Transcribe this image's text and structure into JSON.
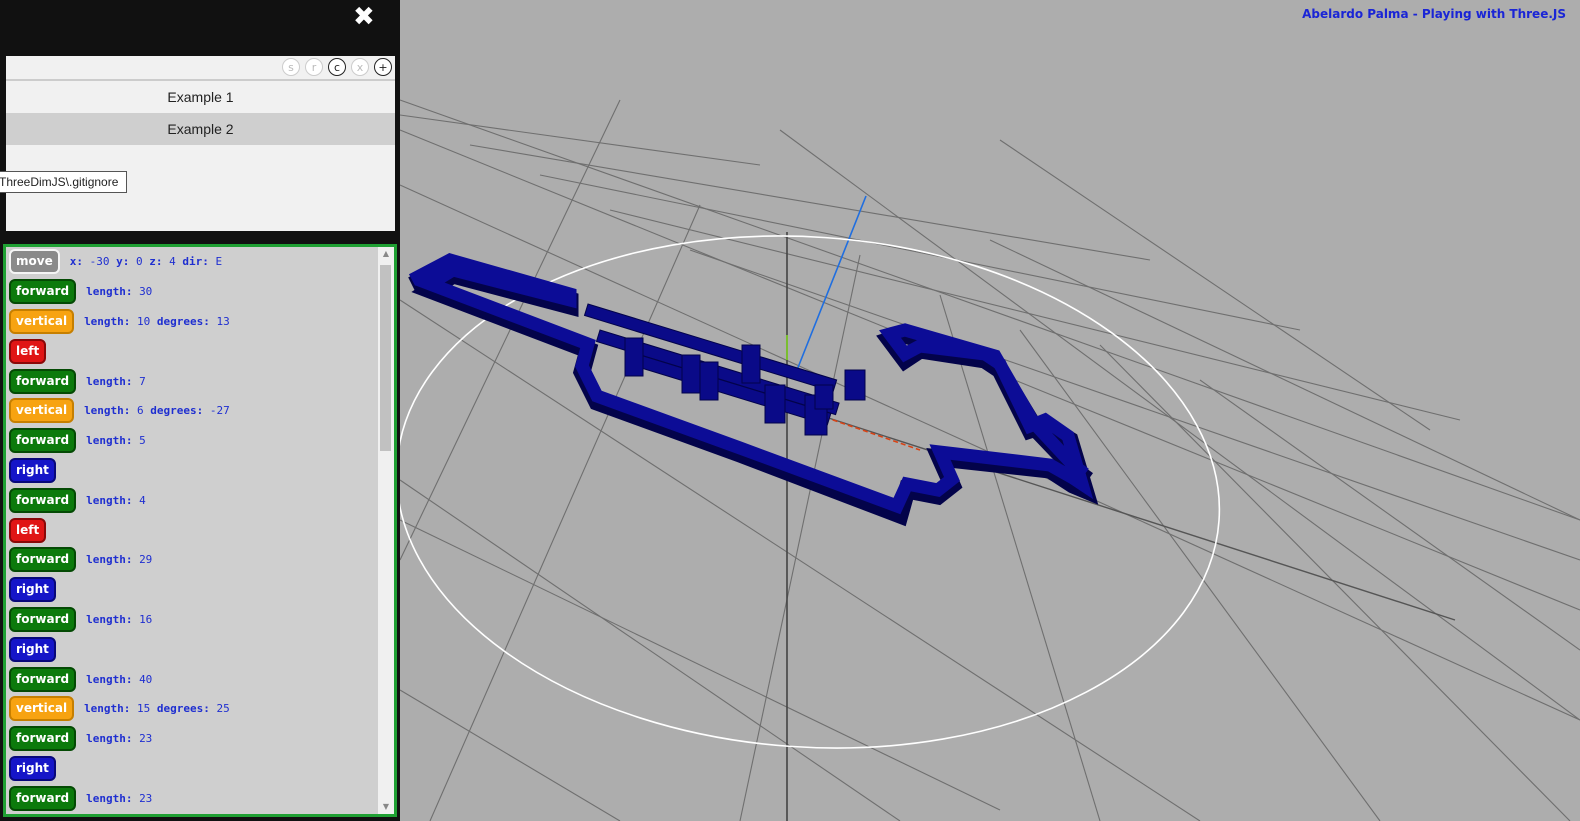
{
  "app": {
    "credit": "Abelardo Palma - Playing with Three.JS"
  },
  "panel": {
    "close_icon": "close-icon"
  },
  "files": {
    "toolbar": [
      "s",
      "r",
      "c",
      "x",
      "+"
    ],
    "active_toolbar": [
      "c",
      "+"
    ],
    "items": [
      {
        "label": "Example 1",
        "selected": false
      },
      {
        "label": "Example 2",
        "selected": true
      }
    ],
    "tooltip": "ThreeDimJS\\.gitignore"
  },
  "commands": [
    {
      "type": "move",
      "label": "move",
      "params": [
        [
          "x:",
          "-30"
        ],
        [
          "y:",
          "0"
        ],
        [
          "z:",
          "4"
        ],
        [
          "dir:",
          "E"
        ]
      ]
    },
    {
      "type": "forward",
      "label": "forward",
      "params": [
        [
          "length:",
          "30"
        ]
      ]
    },
    {
      "type": "vertical",
      "label": "vertical",
      "params": [
        [
          "length:",
          "10"
        ],
        [
          "degrees:",
          "13"
        ]
      ]
    },
    {
      "type": "left",
      "label": "left",
      "params": []
    },
    {
      "type": "forward",
      "label": "forward",
      "params": [
        [
          "length:",
          "7"
        ]
      ]
    },
    {
      "type": "vertical",
      "label": "vertical",
      "params": [
        [
          "length:",
          "6"
        ],
        [
          "degrees:",
          "-27"
        ]
      ]
    },
    {
      "type": "forward",
      "label": "forward",
      "params": [
        [
          "length:",
          "5"
        ]
      ]
    },
    {
      "type": "right",
      "label": "right",
      "params": []
    },
    {
      "type": "forward",
      "label": "forward",
      "params": [
        [
          "length:",
          "4"
        ]
      ]
    },
    {
      "type": "left",
      "label": "left",
      "params": []
    },
    {
      "type": "forward",
      "label": "forward",
      "params": [
        [
          "length:",
          "29"
        ]
      ]
    },
    {
      "type": "right",
      "label": "right",
      "params": []
    },
    {
      "type": "forward",
      "label": "forward",
      "params": [
        [
          "length:",
          "16"
        ]
      ]
    },
    {
      "type": "right",
      "label": "right",
      "params": []
    },
    {
      "type": "forward",
      "label": "forward",
      "params": [
        [
          "length:",
          "40"
        ]
      ]
    },
    {
      "type": "vertical",
      "label": "vertical",
      "params": [
        [
          "length:",
          "15"
        ],
        [
          "degrees:",
          "25"
        ]
      ]
    },
    {
      "type": "forward",
      "label": "forward",
      "params": [
        [
          "length:",
          "23"
        ]
      ]
    },
    {
      "type": "right",
      "label": "right",
      "params": []
    },
    {
      "type": "forward",
      "label": "forward",
      "params": [
        [
          "length:",
          "23"
        ]
      ]
    }
  ],
  "colors": {
    "background": "#adadad",
    "panel": "#111111",
    "track": "#0a0a8c",
    "grid": "#6e6e6e",
    "commands_border": "#1fa033",
    "credit": "#1a25d6"
  }
}
